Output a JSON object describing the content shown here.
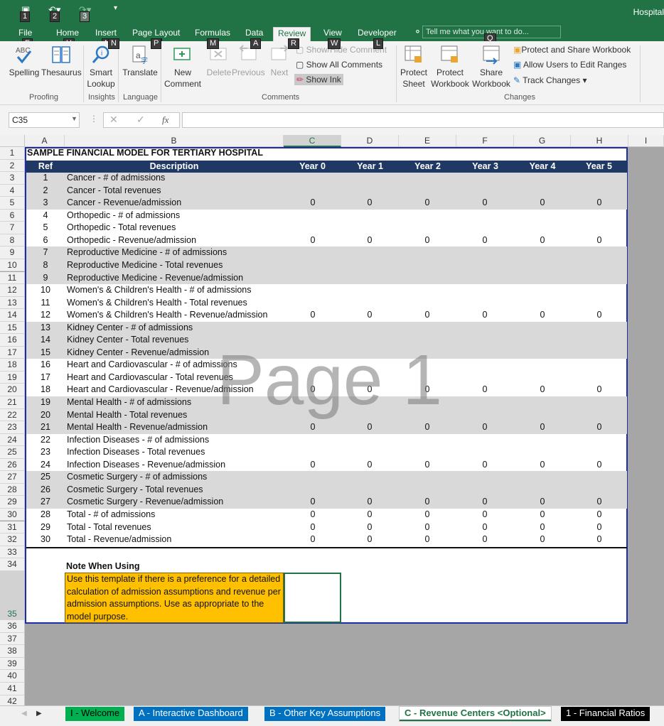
{
  "app": {
    "title_fragment": "Hospital",
    "quick_access": [
      {
        "icon": "save-icon",
        "keytip": "1"
      },
      {
        "icon": "undo-icon",
        "keytip": "2"
      },
      {
        "icon": "redo-icon",
        "keytip": "3"
      },
      {
        "icon": "customize-qat-icon",
        "keytip": ""
      }
    ]
  },
  "tabs": [
    {
      "label": "File",
      "keytip": "F"
    },
    {
      "label": "Home",
      "keytip": "H"
    },
    {
      "label": "Insert",
      "keytip": "N"
    },
    {
      "label": "Page Layout",
      "keytip": "P"
    },
    {
      "label": "Formulas",
      "keytip": "M"
    },
    {
      "label": "Data",
      "keytip": "A"
    },
    {
      "label": "Review",
      "keytip": "R",
      "active": true
    },
    {
      "label": "View",
      "keytip": "W"
    },
    {
      "label": "Developer",
      "keytip": "L"
    }
  ],
  "tell_me": {
    "placeholder": "Tell me what you want to do...",
    "keytip": "Q"
  },
  "ribbon": {
    "proofing": {
      "label": "Proofing",
      "spelling": "Spelling",
      "thesaurus": "Thesaurus"
    },
    "insights": {
      "label": "Insights",
      "smart_lookup_1": "Smart",
      "smart_lookup_2": "Lookup"
    },
    "language": {
      "label": "Language",
      "translate": "Translate"
    },
    "comments": {
      "label": "Comments",
      "new_1": "New",
      "new_2": "Comment",
      "delete": "Delete",
      "previous": "Previous",
      "next": "Next",
      "show_hide": "Show/Hide Comment",
      "show_all": "Show All Comments",
      "show_ink": "Show Ink"
    },
    "changes": {
      "label": "Changes",
      "protect_sheet_1": "Protect",
      "protect_sheet_2": "Sheet",
      "protect_wb_1": "Protect",
      "protect_wb_2": "Workbook",
      "share_wb_1": "Share",
      "share_wb_2": "Workbook",
      "protect_share": "Protect and Share Workbook",
      "allow_users": "Allow Users to Edit Ranges",
      "track_changes": "Track Changes"
    }
  },
  "formula_bar": {
    "name_box": "C35",
    "formula": "",
    "fx": "fx"
  },
  "columns": [
    "A",
    "B",
    "C",
    "D",
    "E",
    "F",
    "G",
    "H",
    "I"
  ],
  "rows": [
    "1",
    "2",
    "3",
    "4",
    "5",
    "6",
    "7",
    "8",
    "9",
    "10",
    "11",
    "12",
    "13",
    "14",
    "15",
    "16",
    "17",
    "18",
    "19",
    "20",
    "21",
    "22",
    "23",
    "24",
    "25",
    "26",
    "27",
    "28",
    "29",
    "30",
    "31",
    "32",
    "33",
    "34",
    "35",
    "36",
    "37",
    "38",
    "39",
    "40",
    "41",
    "42"
  ],
  "sheet": {
    "title": "SAMPLE FINANCIAL MODEL FOR TERTIARY HOSPITAL",
    "headers": [
      "Ref",
      "Description",
      "Year 0",
      "Year 1",
      "Year 2",
      "Year 3",
      "Year 4",
      "Year 5"
    ],
    "data_rows": [
      {
        "ref": "1",
        "desc": "Cancer - # of admissions",
        "vals": []
      },
      {
        "ref": "2",
        "desc": "Cancer - Total revenues",
        "vals": []
      },
      {
        "ref": "3",
        "desc": "Cancer - Revenue/admission",
        "vals": [
          "0",
          "0",
          "0",
          "0",
          "0",
          "0"
        ]
      },
      {
        "ref": "4",
        "desc": "Orthopedic - # of admissions",
        "vals": []
      },
      {
        "ref": "5",
        "desc": "Orthopedic - Total revenues",
        "vals": []
      },
      {
        "ref": "6",
        "desc": "Orthopedic - Revenue/admission",
        "vals": [
          "0",
          "0",
          "0",
          "0",
          "0",
          "0"
        ]
      },
      {
        "ref": "7",
        "desc": "Reproductive Medicine - # of admissions",
        "vals": []
      },
      {
        "ref": "8",
        "desc": "Reproductive Medicine - Total revenues",
        "vals": []
      },
      {
        "ref": "9",
        "desc": "Reproductive Medicine - Revenue/admission",
        "vals": []
      },
      {
        "ref": "10",
        "desc": "Women's & Children's Health - # of admissions",
        "vals": []
      },
      {
        "ref": "11",
        "desc": "Women's & Children's Health - Total revenues",
        "vals": []
      },
      {
        "ref": "12",
        "desc": "Women's & Children's Health - Revenue/admission",
        "vals": [
          "0",
          "0",
          "0",
          "0",
          "0",
          "0"
        ]
      },
      {
        "ref": "13",
        "desc": "Kidney Center - # of admissions",
        "vals": []
      },
      {
        "ref": "14",
        "desc": "Kidney Center - Total revenues",
        "vals": []
      },
      {
        "ref": "15",
        "desc": "Kidney Center - Revenue/admission",
        "vals": []
      },
      {
        "ref": "16",
        "desc": "Heart and Cardiovascular - # of admissions",
        "vals": []
      },
      {
        "ref": "17",
        "desc": "Heart and Cardiovascular - Total revenues",
        "vals": []
      },
      {
        "ref": "18",
        "desc": "Heart and Cardiovascular - Revenue/admission",
        "vals": [
          "0",
          "0",
          "0",
          "0",
          "0",
          "0"
        ]
      },
      {
        "ref": "19",
        "desc": "Mental Health - # of admissions",
        "vals": []
      },
      {
        "ref": "20",
        "desc": "Mental Health - Total revenues",
        "vals": []
      },
      {
        "ref": "21",
        "desc": "Mental Health - Revenue/admission",
        "vals": [
          "0",
          "0",
          "0",
          "0",
          "0",
          "0"
        ]
      },
      {
        "ref": "22",
        "desc": "Infection Diseases - # of admissions",
        "vals": []
      },
      {
        "ref": "23",
        "desc": "Infection Diseases - Total revenues",
        "vals": []
      },
      {
        "ref": "24",
        "desc": "Infection Diseases - Revenue/admission",
        "vals": [
          "0",
          "0",
          "0",
          "0",
          "0",
          "0"
        ]
      },
      {
        "ref": "25",
        "desc": "Cosmetic Surgery - # of admissions",
        "vals": []
      },
      {
        "ref": "26",
        "desc": "Cosmetic Surgery - Total revenues",
        "vals": []
      },
      {
        "ref": "27",
        "desc": "Cosmetic Surgery - Revenue/admission",
        "vals": [
          "0",
          "0",
          "0",
          "0",
          "0",
          "0"
        ]
      },
      {
        "ref": "28",
        "desc": "Total - # of admissions",
        "vals": [
          "0",
          "0",
          "0",
          "0",
          "0",
          "0"
        ]
      },
      {
        "ref": "29",
        "desc": "Total - Total revenues",
        "vals": [
          "0",
          "0",
          "0",
          "0",
          "0",
          "0"
        ]
      },
      {
        "ref": "30",
        "desc": "Total - Revenue/admission",
        "vals": [
          "0",
          "0",
          "0",
          "0",
          "0",
          "0"
        ]
      }
    ],
    "note_title": "Note When Using",
    "note_text": "Use this template if there is a preference for a detailed calculation of admission assumptions and revenue per admission assumptions.  Use as appropriate to the model purpose.",
    "watermark": "Page 1"
  },
  "sheet_tabs": [
    {
      "label": "I - Welcome",
      "bg": "#00b050",
      "fg": "#000000"
    },
    {
      "label": "A - Interactive Dashboard",
      "bg": "#0070c0",
      "fg": "#ffffff"
    },
    {
      "label": "B - Other Key Assumptions",
      "bg": "#0070c0",
      "fg": "#ffffff"
    },
    {
      "label": "C - Revenue Centers <Optional>",
      "bg": "#ffffff",
      "fg": "#217346",
      "active": true
    },
    {
      "label": "1 - Financial Ratios",
      "bg": "#000000",
      "fg": "#ffffff"
    }
  ],
  "colors": {
    "accent": "#217346",
    "header_fill": "#1f3864",
    "band_fill": "#d9d9d9",
    "note_fill": "#ffc000",
    "sheet_border": "#1b2ea7"
  }
}
